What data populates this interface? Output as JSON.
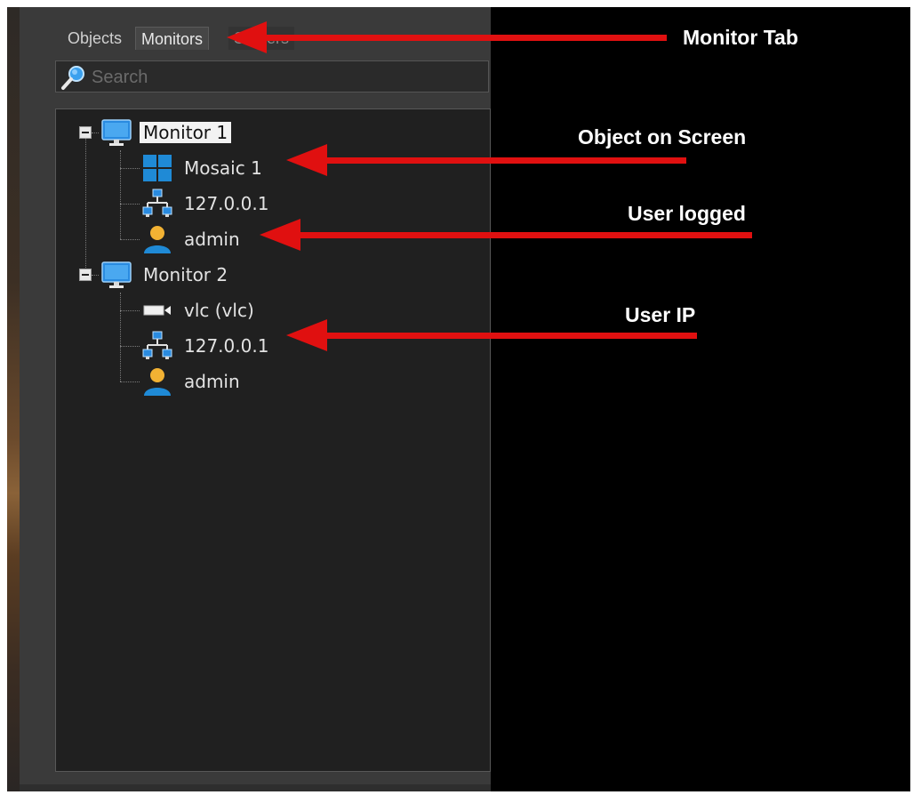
{
  "tabs": [
    {
      "label": "Objects"
    },
    {
      "label": "Monitors"
    },
    {
      "label": "Servers"
    }
  ],
  "search": {
    "placeholder": "Search",
    "value": ""
  },
  "tree": {
    "monitors": [
      {
        "label": "Monitor 1",
        "children": [
          {
            "label": "Mosaic 1",
            "icon": "mosaic-icon"
          },
          {
            "label": "127.0.0.1",
            "icon": "network-icon"
          },
          {
            "label": "admin",
            "icon": "user-icon"
          }
        ]
      },
      {
        "label": "Monitor 2",
        "children": [
          {
            "label": "vlc (vlc)",
            "icon": "camera-icon"
          },
          {
            "label": "127.0.0.1",
            "icon": "network-icon"
          },
          {
            "label": "admin",
            "icon": "user-icon"
          }
        ]
      }
    ]
  },
  "annotations": {
    "monitor_tab": "Monitor Tab",
    "object_on_screen": "Object on Screen",
    "user_logged": "User logged",
    "user_ip": "User IP"
  },
  "colors": {
    "arrow": "#e01010",
    "accent": "#1f8ad6",
    "panel": "#3a3a3a",
    "tree_bg": "#202020"
  }
}
